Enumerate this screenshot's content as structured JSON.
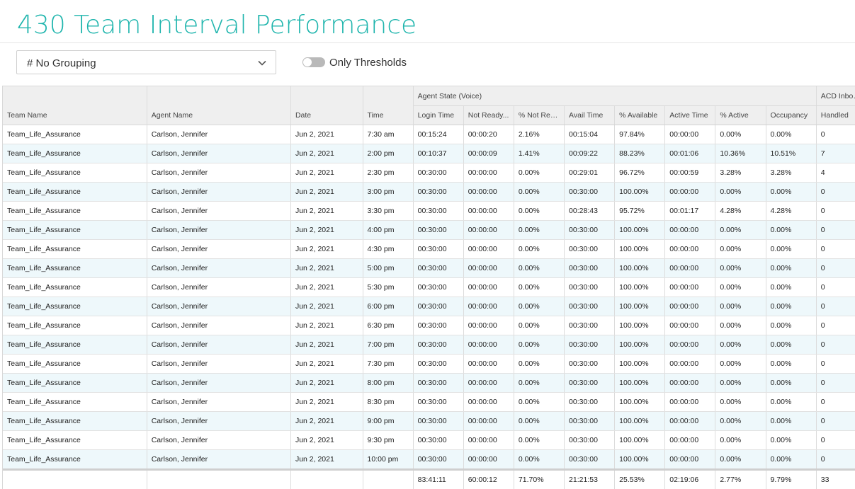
{
  "page": {
    "title": "430 Team Interval Performance"
  },
  "toolbar": {
    "grouping_value": "# No Grouping",
    "thresholds_label": "Only Thresholds",
    "thresholds_on": false
  },
  "table": {
    "group_headers": {
      "agent_state": "Agent State (Voice)",
      "acd_inbound": "ACD Inbound"
    },
    "columns": [
      "Team Name",
      "Agent Name",
      "Date",
      "Time",
      "Login Time",
      "Not Ready...",
      "% Not Rea...",
      "Avail Time",
      "% Available",
      "Active Time",
      "% Active",
      "Occupancy",
      "Handled"
    ],
    "rows": [
      [
        "Team_Life_Assurance",
        "Carlson, Jennifer",
        "Jun 2, 2021",
        "7:30 am",
        "00:15:24",
        "00:00:20",
        "2.16%",
        "00:15:04",
        "97.84%",
        "00:00:00",
        "0.00%",
        "0.00%",
        "0"
      ],
      [
        "Team_Life_Assurance",
        "Carlson, Jennifer",
        "Jun 2, 2021",
        "2:00 pm",
        "00:10:37",
        "00:00:09",
        "1.41%",
        "00:09:22",
        "88.23%",
        "00:01:06",
        "10.36%",
        "10.51%",
        "7"
      ],
      [
        "Team_Life_Assurance",
        "Carlson, Jennifer",
        "Jun 2, 2021",
        "2:30 pm",
        "00:30:00",
        "00:00:00",
        "0.00%",
        "00:29:01",
        "96.72%",
        "00:00:59",
        "3.28%",
        "3.28%",
        "4"
      ],
      [
        "Team_Life_Assurance",
        "Carlson, Jennifer",
        "Jun 2, 2021",
        "3:00 pm",
        "00:30:00",
        "00:00:00",
        "0.00%",
        "00:30:00",
        "100.00%",
        "00:00:00",
        "0.00%",
        "0.00%",
        "0"
      ],
      [
        "Team_Life_Assurance",
        "Carlson, Jennifer",
        "Jun 2, 2021",
        "3:30 pm",
        "00:30:00",
        "00:00:00",
        "0.00%",
        "00:28:43",
        "95.72%",
        "00:01:17",
        "4.28%",
        "4.28%",
        "0"
      ],
      [
        "Team_Life_Assurance",
        "Carlson, Jennifer",
        "Jun 2, 2021",
        "4:00 pm",
        "00:30:00",
        "00:00:00",
        "0.00%",
        "00:30:00",
        "100.00%",
        "00:00:00",
        "0.00%",
        "0.00%",
        "0"
      ],
      [
        "Team_Life_Assurance",
        "Carlson, Jennifer",
        "Jun 2, 2021",
        "4:30 pm",
        "00:30:00",
        "00:00:00",
        "0.00%",
        "00:30:00",
        "100.00%",
        "00:00:00",
        "0.00%",
        "0.00%",
        "0"
      ],
      [
        "Team_Life_Assurance",
        "Carlson, Jennifer",
        "Jun 2, 2021",
        "5:00 pm",
        "00:30:00",
        "00:00:00",
        "0.00%",
        "00:30:00",
        "100.00%",
        "00:00:00",
        "0.00%",
        "0.00%",
        "0"
      ],
      [
        "Team_Life_Assurance",
        "Carlson, Jennifer",
        "Jun 2, 2021",
        "5:30 pm",
        "00:30:00",
        "00:00:00",
        "0.00%",
        "00:30:00",
        "100.00%",
        "00:00:00",
        "0.00%",
        "0.00%",
        "0"
      ],
      [
        "Team_Life_Assurance",
        "Carlson, Jennifer",
        "Jun 2, 2021",
        "6:00 pm",
        "00:30:00",
        "00:00:00",
        "0.00%",
        "00:30:00",
        "100.00%",
        "00:00:00",
        "0.00%",
        "0.00%",
        "0"
      ],
      [
        "Team_Life_Assurance",
        "Carlson, Jennifer",
        "Jun 2, 2021",
        "6:30 pm",
        "00:30:00",
        "00:00:00",
        "0.00%",
        "00:30:00",
        "100.00%",
        "00:00:00",
        "0.00%",
        "0.00%",
        "0"
      ],
      [
        "Team_Life_Assurance",
        "Carlson, Jennifer",
        "Jun 2, 2021",
        "7:00 pm",
        "00:30:00",
        "00:00:00",
        "0.00%",
        "00:30:00",
        "100.00%",
        "00:00:00",
        "0.00%",
        "0.00%",
        "0"
      ],
      [
        "Team_Life_Assurance",
        "Carlson, Jennifer",
        "Jun 2, 2021",
        "7:30 pm",
        "00:30:00",
        "00:00:00",
        "0.00%",
        "00:30:00",
        "100.00%",
        "00:00:00",
        "0.00%",
        "0.00%",
        "0"
      ],
      [
        "Team_Life_Assurance",
        "Carlson, Jennifer",
        "Jun 2, 2021",
        "8:00 pm",
        "00:30:00",
        "00:00:00",
        "0.00%",
        "00:30:00",
        "100.00%",
        "00:00:00",
        "0.00%",
        "0.00%",
        "0"
      ],
      [
        "Team_Life_Assurance",
        "Carlson, Jennifer",
        "Jun 2, 2021",
        "8:30 pm",
        "00:30:00",
        "00:00:00",
        "0.00%",
        "00:30:00",
        "100.00%",
        "00:00:00",
        "0.00%",
        "0.00%",
        "0"
      ],
      [
        "Team_Life_Assurance",
        "Carlson, Jennifer",
        "Jun 2, 2021",
        "9:00 pm",
        "00:30:00",
        "00:00:00",
        "0.00%",
        "00:30:00",
        "100.00%",
        "00:00:00",
        "0.00%",
        "0.00%",
        "0"
      ],
      [
        "Team_Life_Assurance",
        "Carlson, Jennifer",
        "Jun 2, 2021",
        "9:30 pm",
        "00:30:00",
        "00:00:00",
        "0.00%",
        "00:30:00",
        "100.00%",
        "00:00:00",
        "0.00%",
        "0.00%",
        "0"
      ],
      [
        "Team_Life_Assurance",
        "Carlson, Jennifer",
        "Jun 2, 2021",
        "10:00 pm",
        "00:30:00",
        "00:00:00",
        "0.00%",
        "00:30:00",
        "100.00%",
        "00:00:00",
        "0.00%",
        "0.00%",
        "0"
      ]
    ],
    "totals": [
      "",
      "",
      "",
      "",
      "83:41:11",
      "60:00:12",
      "71.70%",
      "21:21:53",
      "25.53%",
      "02:19:06",
      "2.77%",
      "9.79%",
      "33"
    ]
  },
  "colors": {
    "title": "#1fb5ad",
    "row_alt": "#eef8fb",
    "header_bg": "#efefef"
  },
  "icons": {
    "grouping_chevron": "chevron-down-icon"
  }
}
